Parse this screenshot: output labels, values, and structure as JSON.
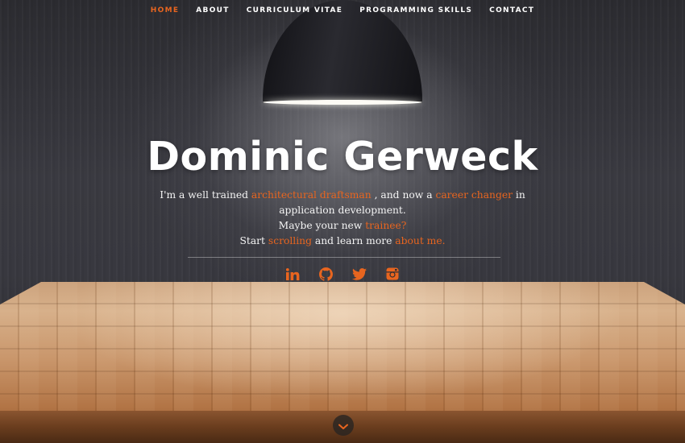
{
  "nav": {
    "items": [
      "HOME",
      "ABOUT",
      "CURRICULUM VITAE",
      "PROGRAMMING SKILLS",
      "CONTACT"
    ],
    "active": "HOME"
  },
  "hero": {
    "title": "Dominic Gerweck",
    "line1_a": "I'm a well trained ",
    "line1_link1": "architectural draftsman",
    "line1_b": " , and now a ",
    "line1_link2": "career changer",
    "line1_c": " in",
    "line2": "application development.",
    "line3_a": "Maybe your new ",
    "line3_link": "trainee?",
    "line4_a": "Start ",
    "line4_link1": "scrolling",
    "line4_b": " and learn more ",
    "line4_link2": "about me."
  },
  "social": {
    "icons": [
      "linkedin-icon",
      "github-icon",
      "twitter-icon",
      "instagram-icon"
    ]
  },
  "colors": {
    "accent": "#e8651f",
    "text": "#ffffff",
    "background": "#2c2c31"
  }
}
